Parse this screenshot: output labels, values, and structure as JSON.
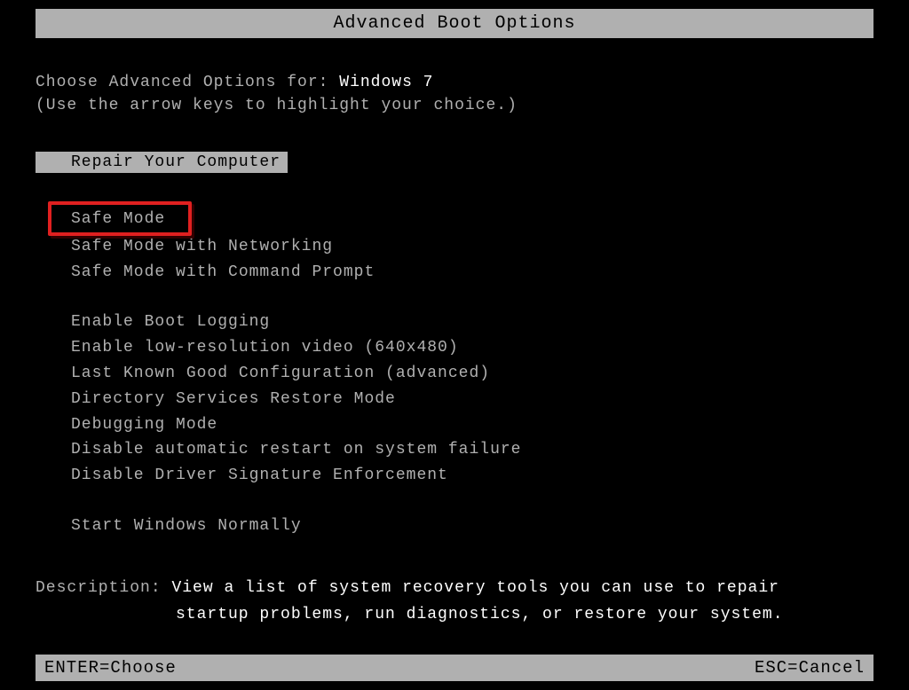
{
  "title": "Advanced Boot Options",
  "prompt": {
    "label": "Choose Advanced Options for: ",
    "os": "Windows 7"
  },
  "hint": "(Use the arrow keys to highlight your choice.)",
  "repair_option": "Repair Your Computer",
  "menu": {
    "group1": [
      "Safe Mode",
      "Safe Mode with Networking",
      "Safe Mode with Command Prompt"
    ],
    "group2": [
      "Enable Boot Logging",
      "Enable low-resolution video (640x480)",
      "Last Known Good Configuration (advanced)",
      "Directory Services Restore Mode",
      "Debugging Mode",
      "Disable automatic restart on system failure",
      "Disable Driver Signature Enforcement"
    ],
    "group3": [
      "Start Windows Normally"
    ]
  },
  "description": {
    "label": "Description: ",
    "line1": "View a list of system recovery tools you can use to repair",
    "line2": "startup problems, run diagnostics, or restore your system."
  },
  "footer": {
    "enter": "ENTER=Choose",
    "esc": "ESC=Cancel"
  }
}
